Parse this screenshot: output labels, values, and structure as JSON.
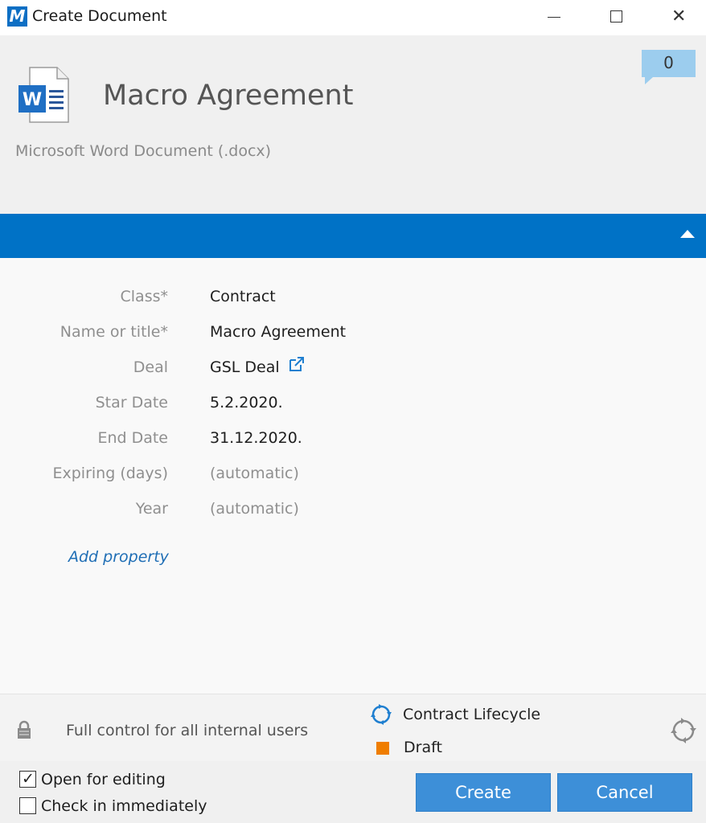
{
  "window": {
    "app_logo": "M",
    "title": "Create Document"
  },
  "header": {
    "document_title": "Macro Agreement",
    "document_type": "Microsoft Word Document (.docx)",
    "comment_count": "0",
    "doc_icon": "word-document-icon",
    "doc_icon_letter": "W"
  },
  "properties": [
    {
      "label": "Class*",
      "value": "Contract",
      "auto": false
    },
    {
      "label": "Name or title*",
      "value": "Macro Agreement",
      "auto": false
    },
    {
      "label": "Deal",
      "value": "GSL Deal",
      "auto": false,
      "has_link": true
    },
    {
      "label": "Star Date",
      "value": "5.2.2020.",
      "auto": false
    },
    {
      "label": "End Date",
      "value": "31.12.2020.",
      "auto": false
    },
    {
      "label": "Expiring (days)",
      "value": "(automatic)",
      "auto": true
    },
    {
      "label": "Year",
      "value": "(automatic)",
      "auto": true
    }
  ],
  "add_property_label": "Add property",
  "status": {
    "permissions": "Full control for all internal users",
    "workflow": "Contract Lifecycle",
    "state": "Draft",
    "state_color": "#ef7d00"
  },
  "options": {
    "open_for_editing": {
      "label": "Open for editing",
      "checked": true,
      "mark": "✓"
    },
    "check_in_immediately": {
      "label": "Check in immediately",
      "checked": false
    }
  },
  "buttons": {
    "create": "Create",
    "cancel": "Cancel"
  },
  "colors": {
    "accent": "#0072c6",
    "button": "#3d8fd8",
    "link": "#1f6eb5",
    "badge": "#9ccdee"
  }
}
